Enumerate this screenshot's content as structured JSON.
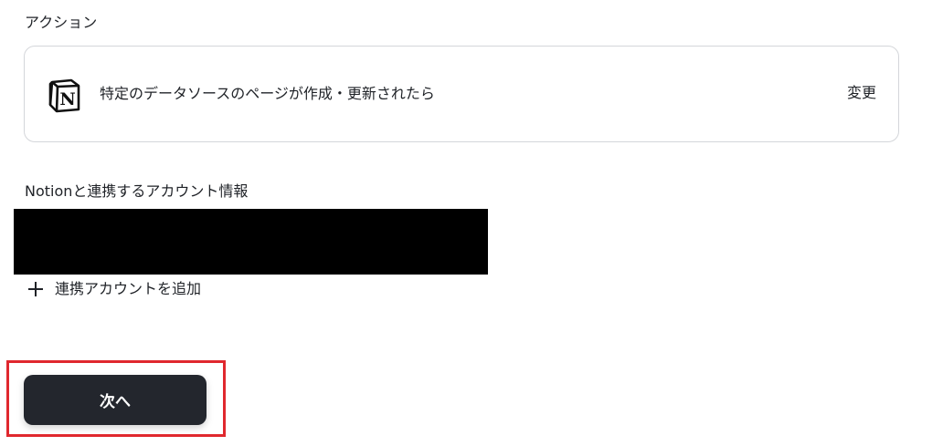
{
  "action_section": {
    "label": "アクション",
    "card": {
      "app_icon": "notion-logo-icon",
      "title": "特定のデータソースのページが作成・更新されたら",
      "change_label": "変更"
    }
  },
  "account_section": {
    "label": "Notionと連携するアカウント情報",
    "account_value_redacted": true,
    "add_account_icon": "plus-icon",
    "add_account_label": "連携アカウントを追加"
  },
  "footer": {
    "next_label": "次へ",
    "highlight_color": "#e0282e"
  },
  "colors": {
    "text": "#1f2227",
    "border": "#d4d6da",
    "button_bg": "#23262d",
    "button_text": "#ffffff"
  }
}
